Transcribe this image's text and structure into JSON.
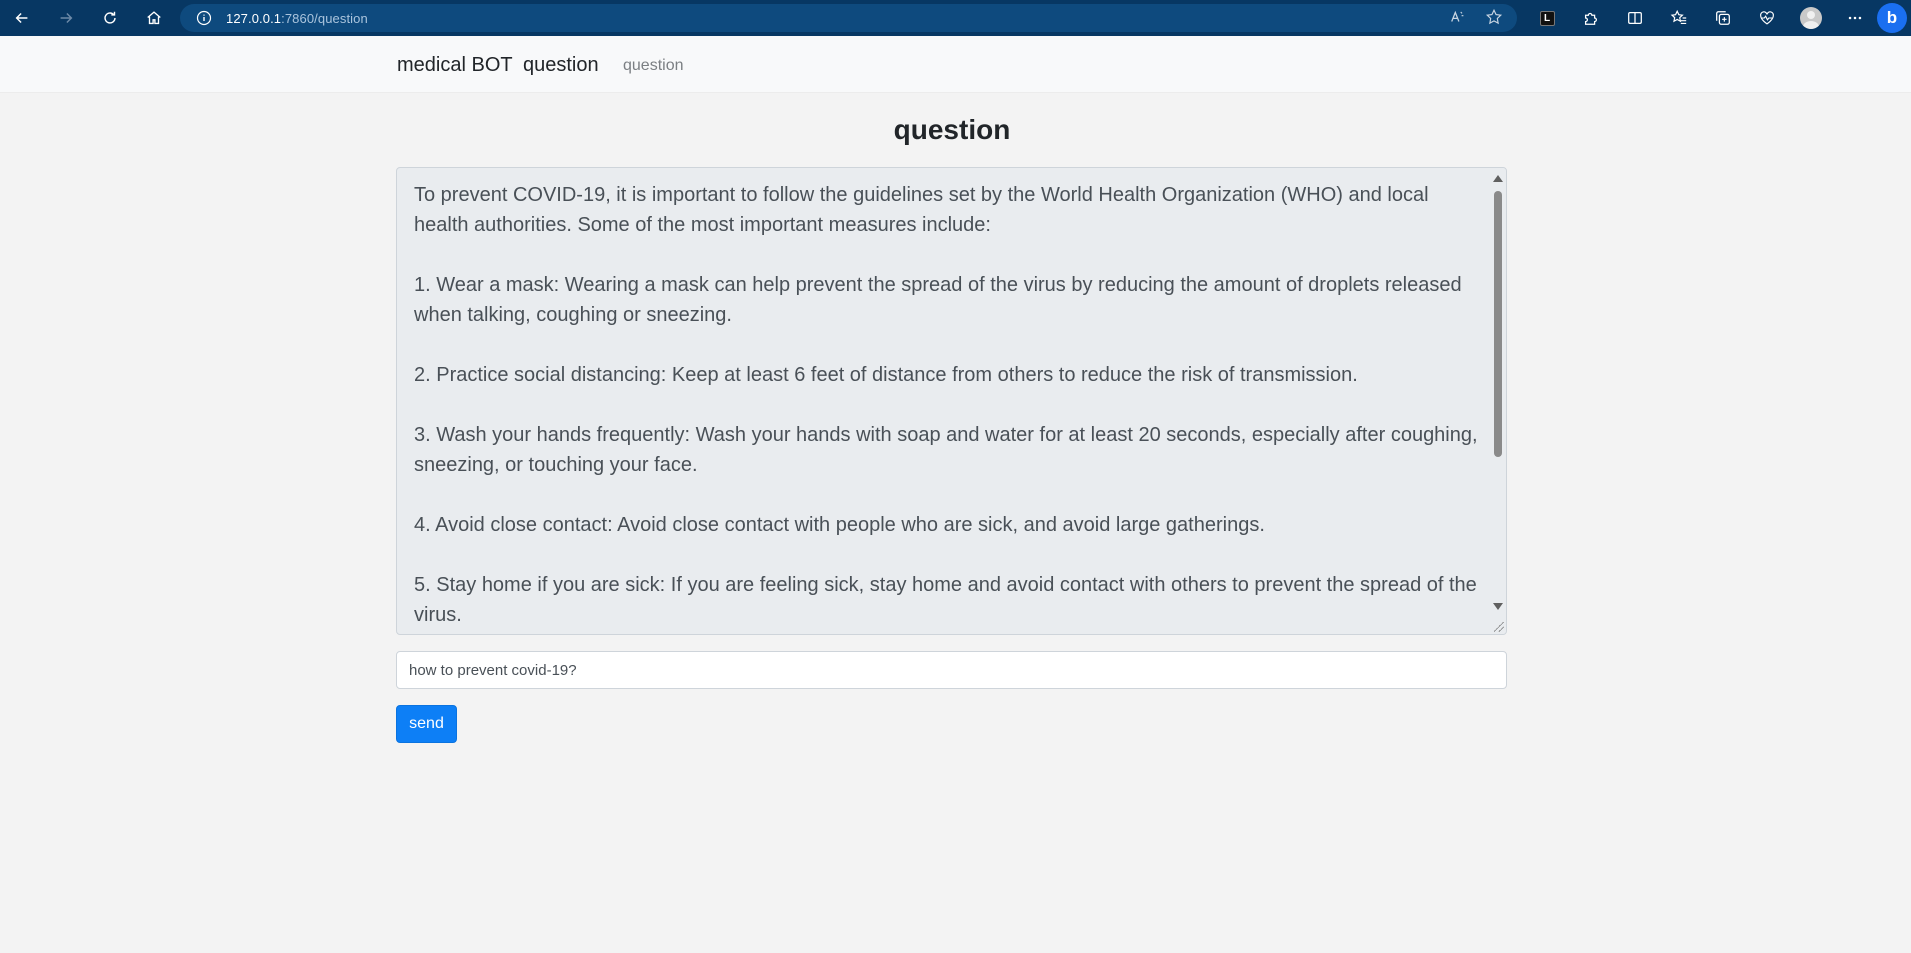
{
  "browser": {
    "url_host": "127.0.0.1",
    "url_path": ":7860/question"
  },
  "navbar": {
    "brand": "medical BOT",
    "link_main": "question",
    "link_sub": "question"
  },
  "page": {
    "title": "question",
    "answer": "To prevent COVID-19, it is important to follow the guidelines set by the World Health Organization (WHO) and local health authorities. Some of the most important measures include:\n\n1. Wear a mask: Wearing a mask can help prevent the spread of the virus by reducing the amount of droplets released when talking, coughing or sneezing.\n\n2. Practice social distancing: Keep at least 6 feet of distance from others to reduce the risk of transmission.\n\n3. Wash your hands frequently: Wash your hands with soap and water for at least 20 seconds, especially after coughing, sneezing, or touching your face.\n\n4. Avoid close contact: Avoid close contact with people who are sick, and avoid large gatherings.\n\n5. Stay home if you are sick: If you are feeling sick, stay home and avoid contact with others to prevent the spread of the virus.",
    "question_value": "how to prevent covid-19?",
    "send_label": "send"
  }
}
